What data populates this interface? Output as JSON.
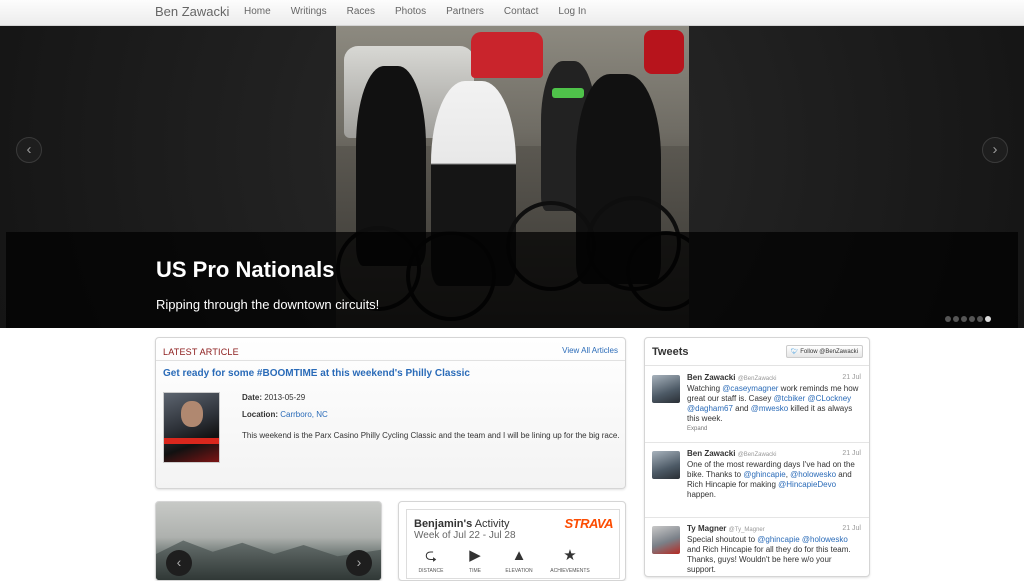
{
  "nav": {
    "brand": "Ben Zawacki",
    "items": [
      "Home",
      "Writings",
      "Races",
      "Photos",
      "Partners",
      "Contact",
      "Log In"
    ]
  },
  "hero": {
    "title": "US Pro Nationals",
    "subtitle": "Ripping through the downtown circuits!",
    "prev_icon": "‹",
    "next_icon": "›",
    "slide_count": 6,
    "active_slide": 6
  },
  "latest": {
    "label": "LATEST ARTICLE",
    "view_all": "View All Articles",
    "title": "Get ready for some #BOOMTIME at this weekend's Philly Classic",
    "date_label": "Date:",
    "date": "2013-05-29",
    "location_label": "Location:",
    "location": "Carrboro, NC",
    "body": "This weekend is the Parx Casino Philly Cycling Classic and the team and I will be lining up for the big race."
  },
  "photo_carousel": {
    "prev_icon": "‹",
    "next_icon": "›"
  },
  "strava": {
    "name": "Benjamin's",
    "name_suffix": "Activity",
    "week": "Week of Jul 22 - Jul 28",
    "logo": "STRAVA",
    "stats": [
      {
        "icon": "distance-icon",
        "label": "DISTANCE"
      },
      {
        "icon": "time-icon",
        "label": "TIME"
      },
      {
        "icon": "elevation-icon",
        "label": "ELEVATION"
      },
      {
        "icon": "achievements-icon",
        "label": "ACHIEVEMENTS"
      }
    ]
  },
  "tweets": {
    "title": "Tweets",
    "follow_label": "Follow @BenZawacki",
    "items": [
      {
        "name": "Ben Zawacki",
        "handle": "@BenZawacki",
        "date": "21 Jul",
        "parts": [
          "Watching ",
          "@caseymagner",
          " work reminds me how great our staff is. Casey ",
          "@tcbiker",
          " ",
          "@CLockney",
          " ",
          "@dagham67",
          " and ",
          "@mwesko",
          " killed it as always this week."
        ],
        "expand": "Expand"
      },
      {
        "name": "Ben Zawacki",
        "handle": "@BenZawacki",
        "date": "21 Jul",
        "parts": [
          "One of the most rewarding days I've had on the bike. Thanks to ",
          "@ghincapie",
          ", ",
          "@holowesko",
          " and Rich Hincapie for making ",
          "@HincapieDevo",
          " happen."
        ]
      },
      {
        "name": "Ty Magner",
        "handle": "@Ty_Magner",
        "date": "21 Jul",
        "parts": [
          "Special shoutout to ",
          "@ghincapie",
          " ",
          "@holowesko",
          " and Rich Hincapie for all they do for this team. Thanks, guys! Wouldn't be here w/o your support."
        ]
      }
    ]
  },
  "colors": {
    "link": "#2a6bb8",
    "latest_label": "#8b1a1a",
    "strava": "#fc4c02"
  }
}
